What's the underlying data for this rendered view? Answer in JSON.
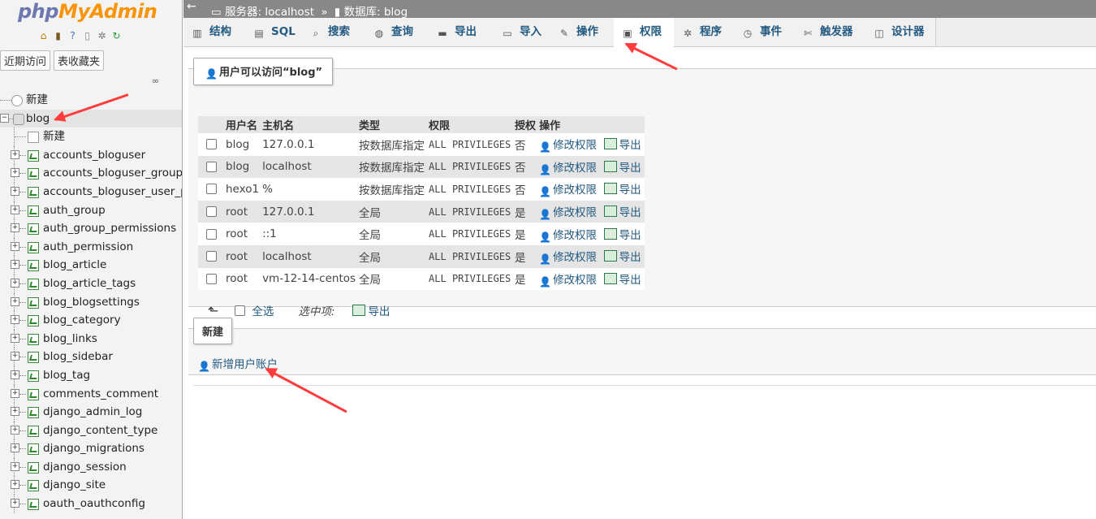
{
  "logo": {
    "part1": "php",
    "part2": "MyAdmin"
  },
  "sidebar": {
    "quick_icons": [
      "home-icon",
      "exit-icon",
      "help-icon",
      "docs-icon",
      "settings-icon",
      "reload-icon"
    ],
    "nav_tabs": [
      "近期访问",
      "表收藏夹"
    ],
    "new_root": "新建",
    "db_name": "blog",
    "db_new": "新建",
    "tables": [
      "accounts_bloguser",
      "accounts_bloguser_groups",
      "accounts_bloguser_user_pe",
      "auth_group",
      "auth_group_permissions",
      "auth_permission",
      "blog_article",
      "blog_article_tags",
      "blog_blogsettings",
      "blog_category",
      "blog_links",
      "blog_sidebar",
      "blog_tag",
      "comments_comment",
      "django_admin_log",
      "django_content_type",
      "django_migrations",
      "django_session",
      "django_site",
      "oauth_oauthconfig"
    ]
  },
  "breadcrumb": {
    "server_label": "服务器:",
    "server": "localhost",
    "sep": "»",
    "db_label": "数据库:",
    "db": "blog"
  },
  "tabs": [
    {
      "label": "结构",
      "icon": "structure-icon"
    },
    {
      "label": "SQL",
      "icon": "sql-icon"
    },
    {
      "label": "搜索",
      "icon": "search-icon"
    },
    {
      "label": "查询",
      "icon": "query-icon"
    },
    {
      "label": "导出",
      "icon": "export-icon"
    },
    {
      "label": "导入",
      "icon": "import-icon"
    },
    {
      "label": "操作",
      "icon": "wrench-icon"
    },
    {
      "label": "权限",
      "icon": "privileges-icon"
    },
    {
      "label": "程序",
      "icon": "routines-icon"
    },
    {
      "label": "事件",
      "icon": "events-icon"
    },
    {
      "label": "触发器",
      "icon": "triggers-icon"
    },
    {
      "label": "设计器",
      "icon": "designer-icon"
    }
  ],
  "active_tab": "权限",
  "users_section": {
    "legend": "用户可以访问“blog”",
    "headers": [
      "用户名",
      "主机名",
      "类型",
      "权限",
      "授权",
      "操作"
    ],
    "rows": [
      {
        "user": "blog",
        "host": "127.0.0.1",
        "type": "按数据库指定",
        "priv": "ALL PRIVILEGES",
        "grant": "否",
        "edit": "修改权限",
        "export": "导出"
      },
      {
        "user": "blog",
        "host": "localhost",
        "type": "按数据库指定",
        "priv": "ALL PRIVILEGES",
        "grant": "否",
        "edit": "修改权限",
        "export": "导出"
      },
      {
        "user": "hexo1",
        "host": "%",
        "type": "按数据库指定",
        "priv": "ALL PRIVILEGES",
        "grant": "否",
        "edit": "修改权限",
        "export": "导出"
      },
      {
        "user": "root",
        "host": "127.0.0.1",
        "type": "全局",
        "priv": "ALL PRIVILEGES",
        "grant": "是",
        "edit": "修改权限",
        "export": "导出"
      },
      {
        "user": "root",
        "host": "::1",
        "type": "全局",
        "priv": "ALL PRIVILEGES",
        "grant": "是",
        "edit": "修改权限",
        "export": "导出"
      },
      {
        "user": "root",
        "host": "localhost",
        "type": "全局",
        "priv": "ALL PRIVILEGES",
        "grant": "是",
        "edit": "修改权限",
        "export": "导出"
      },
      {
        "user": "root",
        "host": "vm-12-14-centos",
        "type": "全局",
        "priv": "ALL PRIVILEGES",
        "grant": "是",
        "edit": "修改权限",
        "export": "导出"
      }
    ],
    "select_all": "全选",
    "with_selected": "选中项:",
    "bulk_export": "导出"
  },
  "new_section": {
    "legend": "新建",
    "add_user": "新增用户账户"
  },
  "colors": {
    "annotation_arrow": "#ff3b3b",
    "link": "#235a81",
    "topbar": "#888888"
  }
}
